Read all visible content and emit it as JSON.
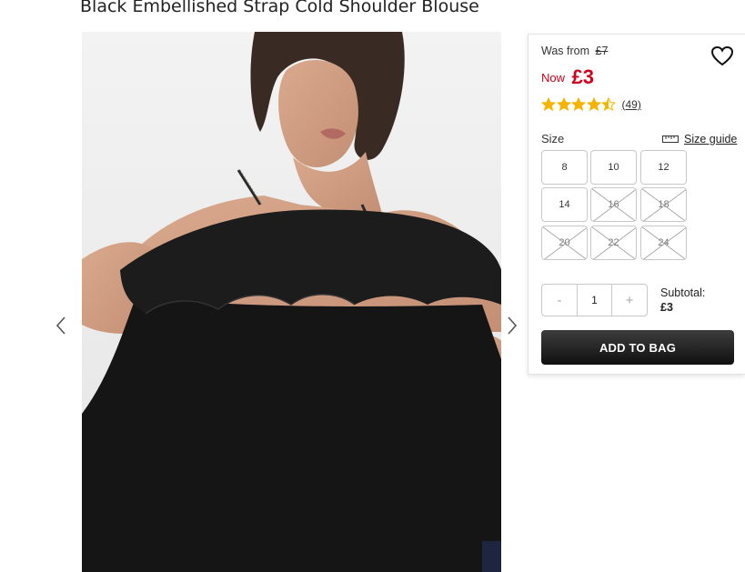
{
  "product": {
    "title": "Black Embellished Strap Cold Shoulder Blouse",
    "image_alt": "Woman wearing black off-shoulder ruffle blouse",
    "was_label": "Was from",
    "was_price": "£7",
    "now_label": "Now",
    "now_price": "£3",
    "rating": 4.5,
    "review_count": "(49)"
  },
  "size": {
    "label": "Size",
    "guide_label": "Size guide",
    "options": [
      {
        "value": "8",
        "available": true
      },
      {
        "value": "10",
        "available": true
      },
      {
        "value": "12",
        "available": true
      },
      {
        "value": "14",
        "available": true
      },
      {
        "value": "16",
        "available": false
      },
      {
        "value": "18",
        "available": false
      },
      {
        "value": "20",
        "available": false
      },
      {
        "value": "22",
        "available": false
      },
      {
        "value": "24",
        "available": false
      }
    ]
  },
  "quantity": {
    "minus": "-",
    "value": "1",
    "plus": "+"
  },
  "subtotal": {
    "label": "Subtotal:",
    "value": "£3"
  },
  "actions": {
    "add_to_bag": "ADD TO BAG"
  },
  "colors": {
    "sale_red": "#d0021b",
    "star_gold": "#f5b400",
    "button_dark": "#1a1a1a"
  },
  "icons": {
    "wishlist": "heart-outline-icon",
    "size_guide": "ruler-icon",
    "prev": "chevron-left-icon",
    "next": "chevron-right-icon"
  }
}
